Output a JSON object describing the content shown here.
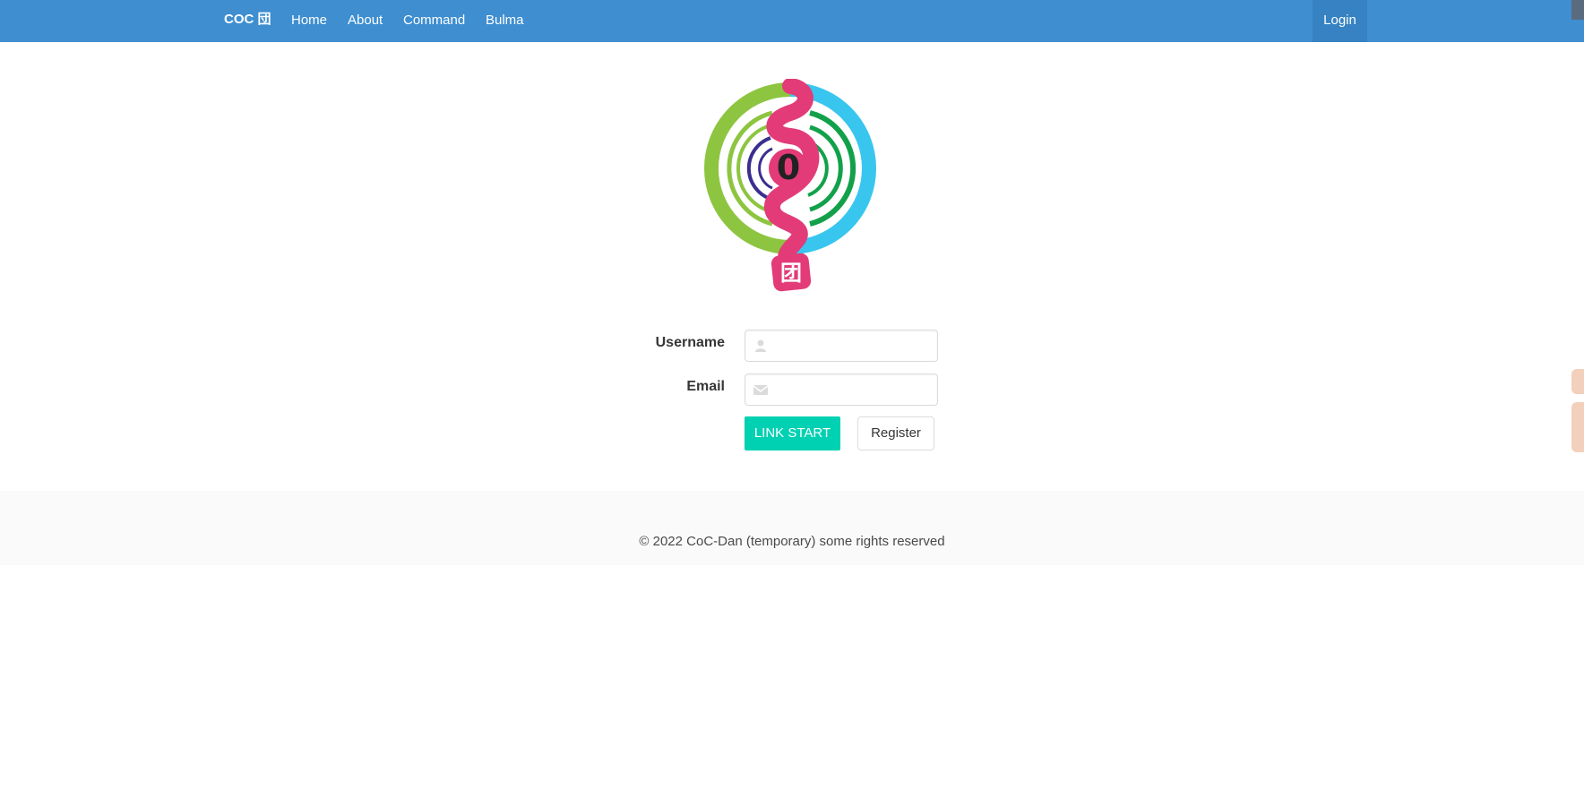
{
  "navbar": {
    "brand": "COC 団",
    "items": [
      {
        "label": "Home"
      },
      {
        "label": "About"
      },
      {
        "label": "Command"
      },
      {
        "label": "Bulma"
      }
    ],
    "login_label": "Login",
    "background": "#3e8ed0"
  },
  "logo": {
    "center_char": "0",
    "badge_char": "团"
  },
  "form": {
    "username_label": "Username",
    "username_value": "",
    "username_icon": "user-icon",
    "email_label": "Email",
    "email_value": "",
    "email_icon": "envelope-icon",
    "submit_label": "LINK START",
    "register_label": "Register",
    "accent": "#00d1b2"
  },
  "footer": {
    "text": "© 2022 CoC-Dan (temporary) some rights reserved"
  }
}
